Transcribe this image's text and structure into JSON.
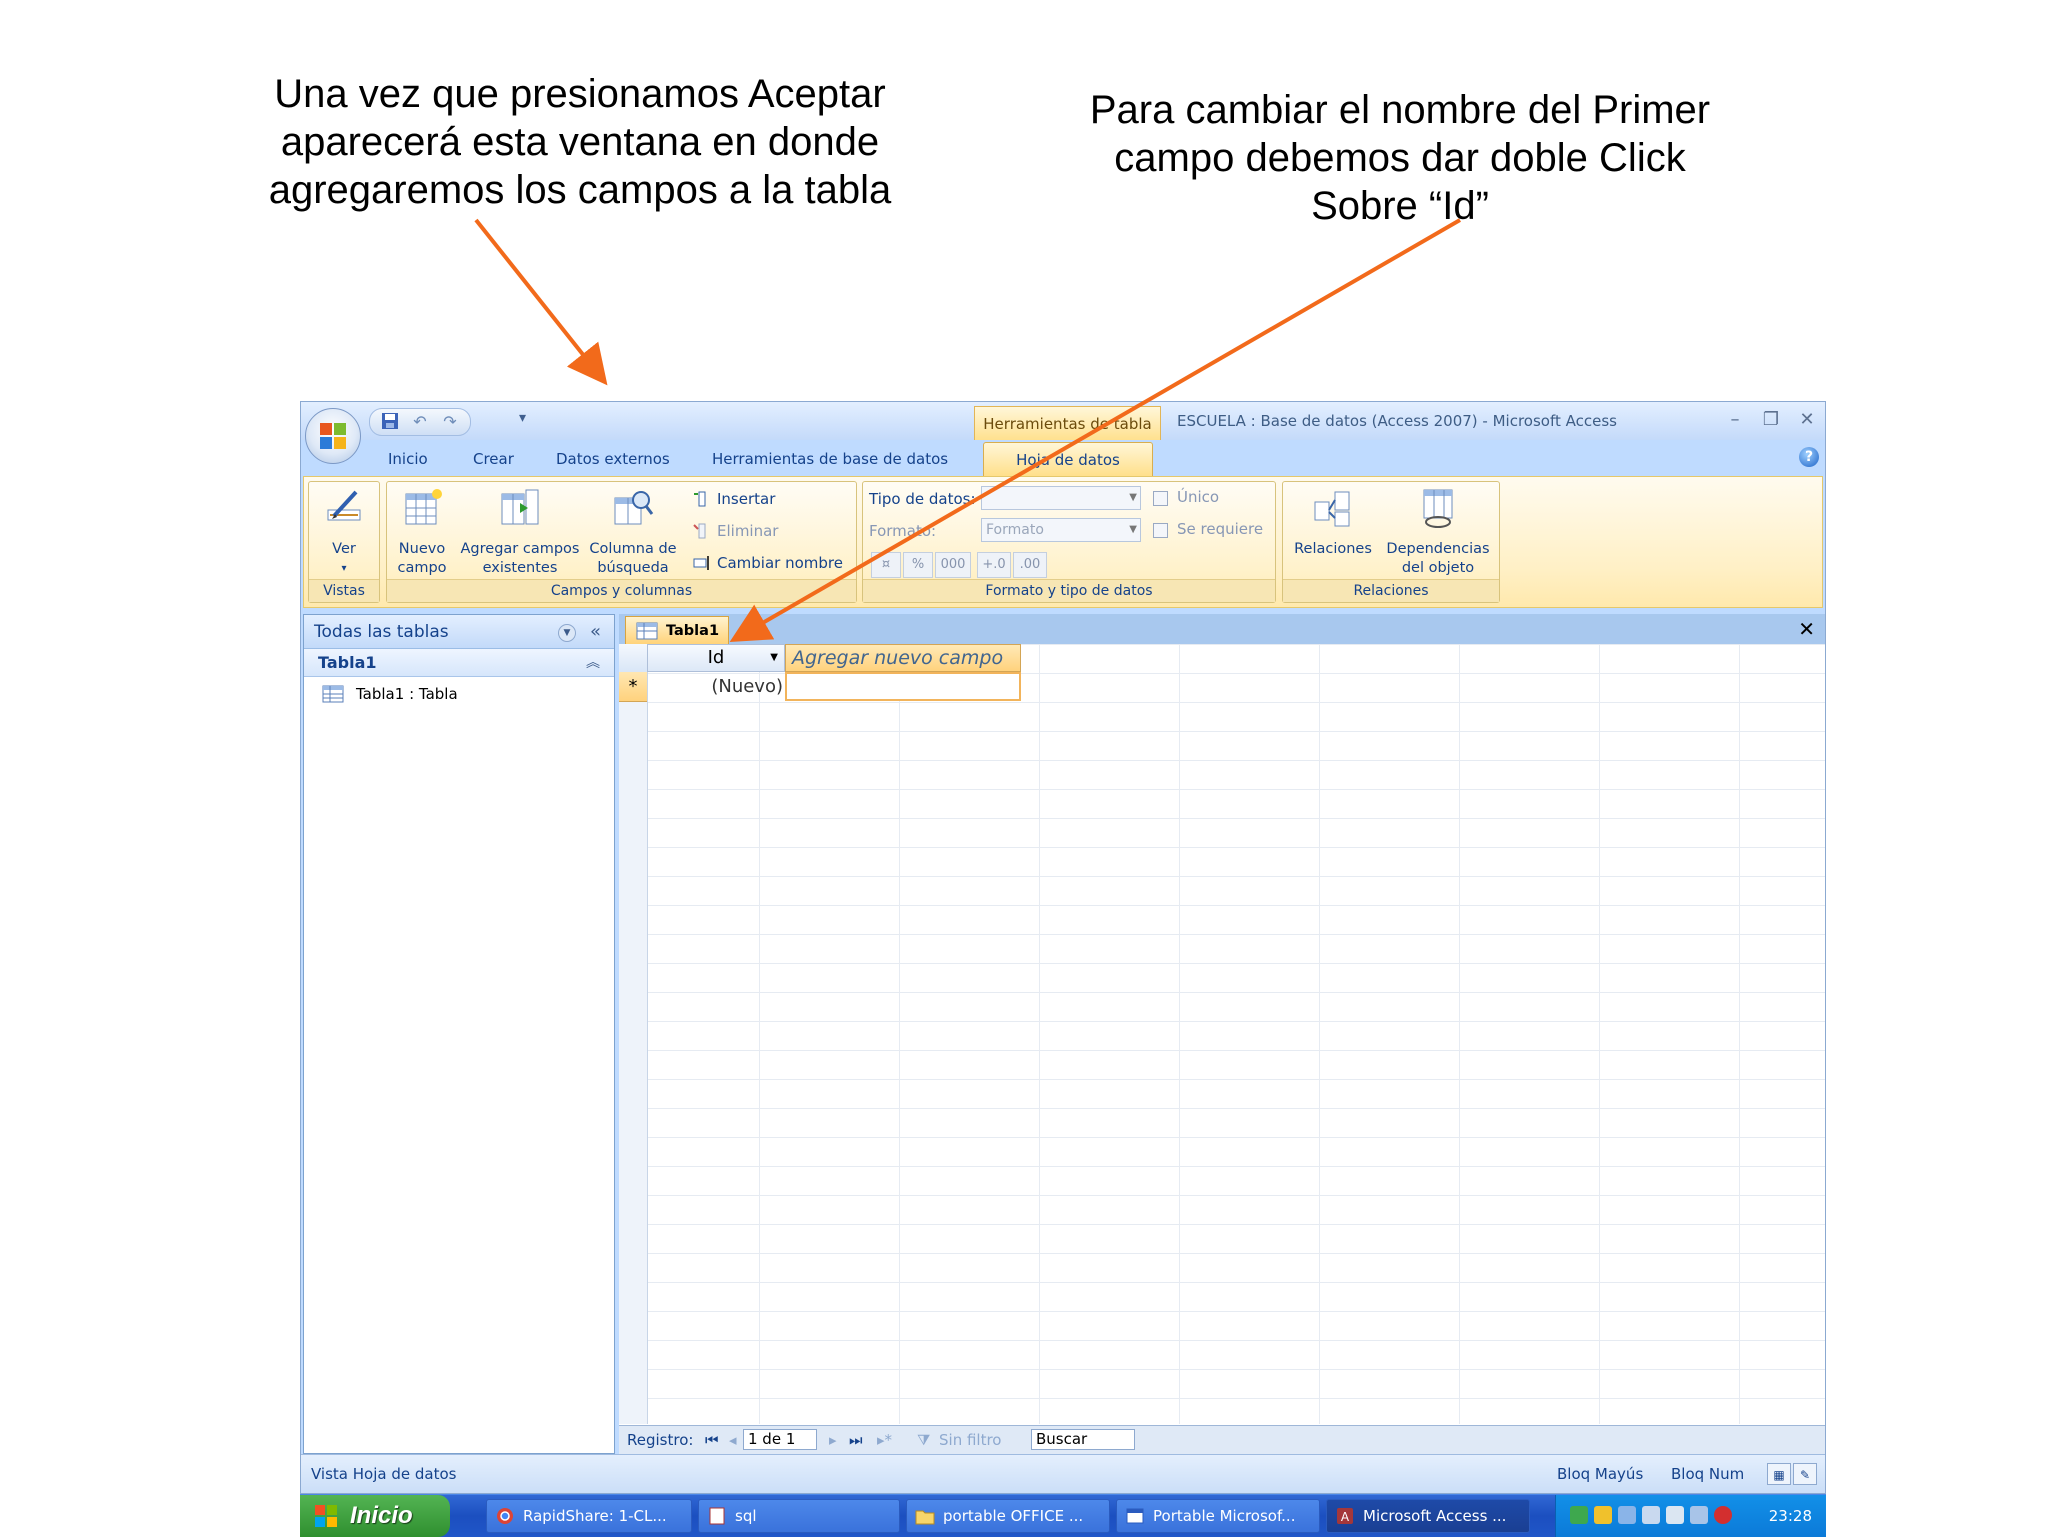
{
  "captions": {
    "left": "Una vez que presionamos Aceptar aparecerá esta ventana en donde agregaremos los campos a la tabla",
    "right": "Para cambiar el nombre del Primer campo debemos dar doble Click Sobre “Id”"
  },
  "titlebar": {
    "contextual_tools": "Herramientas de tabla",
    "window_title": "ESCUELA : Base de datos (Access 2007) - Microsoft Access"
  },
  "tabs": [
    "Inicio",
    "Crear",
    "Datos externos",
    "Herramientas de base de datos"
  ],
  "active_tab": "Hoja de datos",
  "ribbon": {
    "vistas": {
      "label": "Vistas",
      "ver": "Ver"
    },
    "campos": {
      "label": "Campos y columnas",
      "nuevo_l1": "Nuevo",
      "nuevo_l2": "campo",
      "agregar_l1": "Agregar campos",
      "agregar_l2": "existentes",
      "columna_l1": "Columna de",
      "columna_l2": "búsqueda",
      "insertar": "Insertar",
      "eliminar": "Eliminar",
      "cambiar": "Cambiar nombre"
    },
    "formato": {
      "label": "Formato y tipo de datos",
      "tipo": "Tipo de datos:",
      "formato": "Formato:",
      "formato_placeholder": "Formato",
      "unico": "Único",
      "requiere": "Se requiere",
      "pct": "%",
      "miles": "000"
    },
    "relaciones": {
      "label": "Relaciones",
      "rel": "Relaciones",
      "dep_l1": "Dependencias",
      "dep_l2": "del objeto"
    }
  },
  "nav": {
    "header": "Todas las tablas",
    "group": "Tabla1",
    "item": "Tabla1 : Tabla"
  },
  "datasheet": {
    "tab": "Tabla1",
    "col_id": "Id",
    "col_new": "Agregar nuevo campo",
    "new_row_marker": "*",
    "new_row_value": "(Nuevo)"
  },
  "record_nav": {
    "label": "Registro:",
    "position": "1 de 1",
    "filter": "Sin filtro",
    "search": "Buscar"
  },
  "status": {
    "left": "Vista Hoja de datos",
    "caps": "Bloq Mayús",
    "num": "Bloq Num"
  },
  "taskbar": {
    "start": "Inicio",
    "tasks": [
      "RapidShare: 1-CL...",
      "sql",
      "portable OFFICE ...",
      "Portable Microsof...",
      "Microsoft Access ..."
    ],
    "clock": "23:28"
  },
  "colors": {
    "arrow": "#f26a1b",
    "ribbon_accent": "#ffd37a",
    "frame_blue": "#bfdbff"
  }
}
